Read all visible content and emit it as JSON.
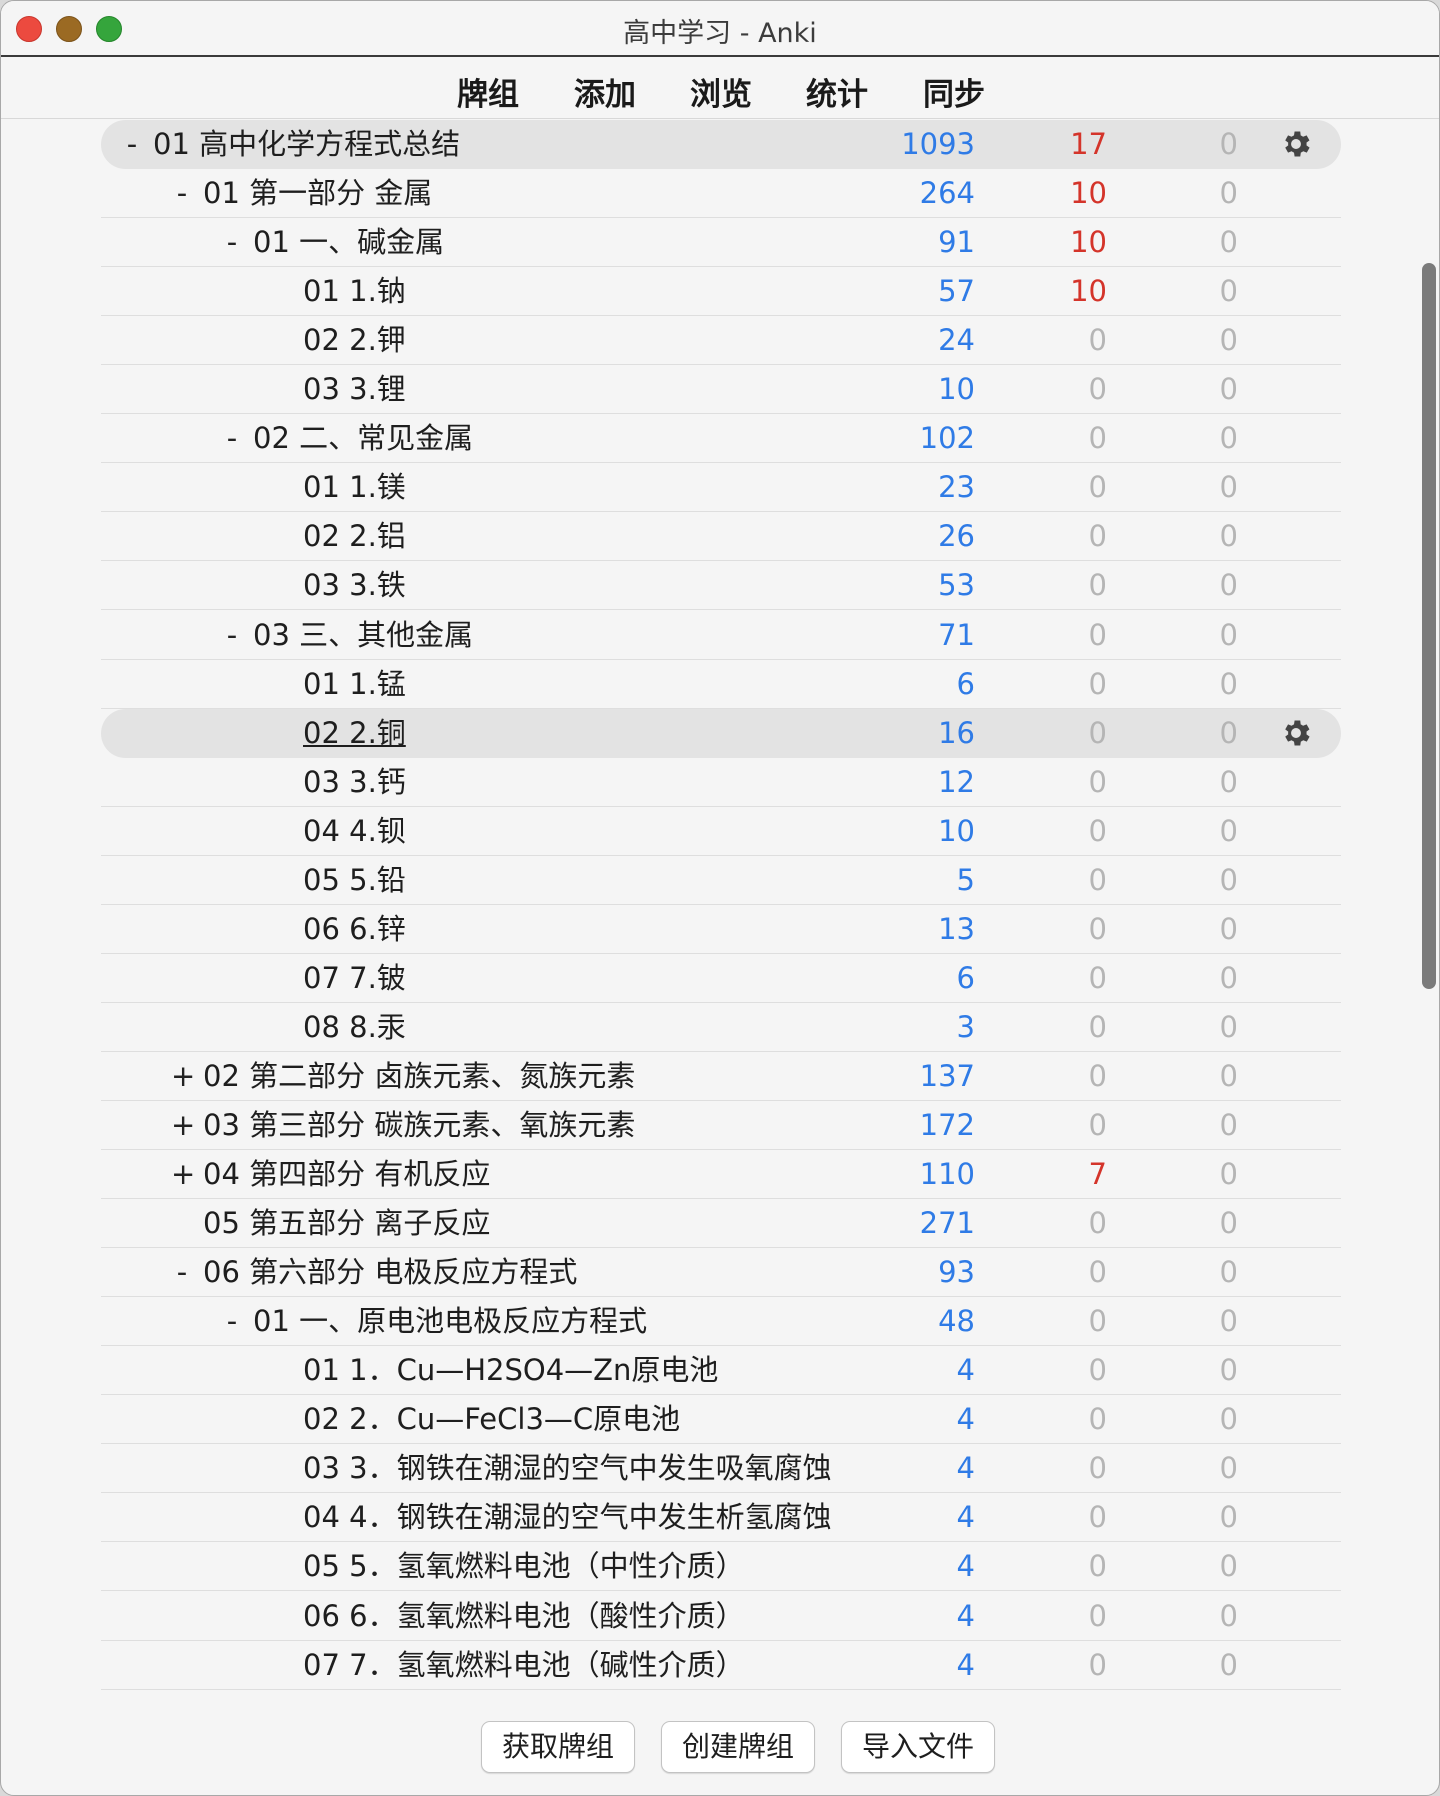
{
  "window": {
    "title": "高中学习 - Anki"
  },
  "toolbar": {
    "items": [
      "牌组",
      "添加",
      "浏览",
      "统计",
      "同步"
    ]
  },
  "decks": [
    {
      "toggle": "-",
      "name": "01 高中化学方程式总结",
      "level": 0,
      "new": "1093",
      "learn": "17",
      "review": "0",
      "current": true,
      "gear": true
    },
    {
      "toggle": "-",
      "name": "01 第一部分 金属",
      "level": 1,
      "new": "264",
      "learn": "10",
      "review": "0"
    },
    {
      "toggle": "-",
      "name": "01 一、碱金属",
      "level": 2,
      "new": "91",
      "learn": "10",
      "review": "0"
    },
    {
      "toggle": "",
      "name": "01 1.钠",
      "level": 3,
      "new": "57",
      "learn": "10",
      "review": "0"
    },
    {
      "toggle": "",
      "name": "02 2.钾",
      "level": 3,
      "new": "24",
      "learn": "0",
      "review": "0"
    },
    {
      "toggle": "",
      "name": "03 3.锂",
      "level": 3,
      "new": "10",
      "learn": "0",
      "review": "0"
    },
    {
      "toggle": "-",
      "name": "02 二、常见金属",
      "level": 2,
      "new": "102",
      "learn": "0",
      "review": "0"
    },
    {
      "toggle": "",
      "name": "01 1.镁",
      "level": 3,
      "new": "23",
      "learn": "0",
      "review": "0"
    },
    {
      "toggle": "",
      "name": "02 2.铝",
      "level": 3,
      "new": "26",
      "learn": "0",
      "review": "0"
    },
    {
      "toggle": "",
      "name": "03 3.铁",
      "level": 3,
      "new": "53",
      "learn": "0",
      "review": "0"
    },
    {
      "toggle": "-",
      "name": "03 三、其他金属",
      "level": 2,
      "new": "71",
      "learn": "0",
      "review": "0"
    },
    {
      "toggle": "",
      "name": "01 1.锰",
      "level": 3,
      "new": "6",
      "learn": "0",
      "review": "0"
    },
    {
      "toggle": "",
      "name": "02 2.铜",
      "level": 3,
      "new": "16",
      "learn": "0",
      "review": "0",
      "current": true,
      "gear": true,
      "underline": true
    },
    {
      "toggle": "",
      "name": "03 3.钙",
      "level": 3,
      "new": "12",
      "learn": "0",
      "review": "0"
    },
    {
      "toggle": "",
      "name": "04 4.钡",
      "level": 3,
      "new": "10",
      "learn": "0",
      "review": "0"
    },
    {
      "toggle": "",
      "name": "05 5.铅",
      "level": 3,
      "new": "5",
      "learn": "0",
      "review": "0"
    },
    {
      "toggle": "",
      "name": "06 6.锌",
      "level": 3,
      "new": "13",
      "learn": "0",
      "review": "0"
    },
    {
      "toggle": "",
      "name": "07 7.铍",
      "level": 3,
      "new": "6",
      "learn": "0",
      "review": "0"
    },
    {
      "toggle": "",
      "name": "08 8.汞",
      "level": 3,
      "new": "3",
      "learn": "0",
      "review": "0"
    },
    {
      "toggle": "+",
      "name": "02 第二部分 卤族元素、氮族元素",
      "level": 1,
      "new": "137",
      "learn": "0",
      "review": "0"
    },
    {
      "toggle": "+",
      "name": "03 第三部分 碳族元素、氧族元素",
      "level": 1,
      "new": "172",
      "learn": "0",
      "review": "0"
    },
    {
      "toggle": "+",
      "name": "04 第四部分 有机反应",
      "level": 1,
      "new": "110",
      "learn": "7",
      "review": "0"
    },
    {
      "toggle": "",
      "name": "05 第五部分 离子反应",
      "level": 1,
      "new": "271",
      "learn": "0",
      "review": "0"
    },
    {
      "toggle": "-",
      "name": "06 第六部分 电极反应方程式",
      "level": 1,
      "new": "93",
      "learn": "0",
      "review": "0"
    },
    {
      "toggle": "-",
      "name": "01 一、原电池电极反应方程式",
      "level": 2,
      "new": "48",
      "learn": "0",
      "review": "0"
    },
    {
      "toggle": "",
      "name": "01 1．Cu—H2SO4—Zn原电池",
      "level": 3,
      "new": "4",
      "learn": "0",
      "review": "0"
    },
    {
      "toggle": "",
      "name": "02 2．Cu—FeCl3—C原电池",
      "level": 3,
      "new": "4",
      "learn": "0",
      "review": "0"
    },
    {
      "toggle": "",
      "name": "03 3．钢铁在潮湿的空气中发生吸氧腐蚀",
      "level": 3,
      "new": "4",
      "learn": "0",
      "review": "0"
    },
    {
      "toggle": "",
      "name": "04 4．钢铁在潮湿的空气中发生析氢腐蚀",
      "level": 3,
      "new": "4",
      "learn": "0",
      "review": "0"
    },
    {
      "toggle": "",
      "name": "05 5．氢氧燃料电池（中性介质）",
      "level": 3,
      "new": "4",
      "learn": "0",
      "review": "0"
    },
    {
      "toggle": "",
      "name": "06 6．氢氧燃料电池（酸性介质）",
      "level": 3,
      "new": "4",
      "learn": "0",
      "review": "0"
    },
    {
      "toggle": "",
      "name": "07 7．氢氧燃料电池（碱性介质）",
      "level": 3,
      "new": "4",
      "learn": "0",
      "review": "0"
    }
  ],
  "buttons": {
    "get_shared": "获取牌组",
    "create_deck": "创建牌组",
    "import_file": "导入文件"
  },
  "colors": {
    "new": "#2f7be6",
    "learn": "#d4342a",
    "zero": "#b5b5b5"
  }
}
